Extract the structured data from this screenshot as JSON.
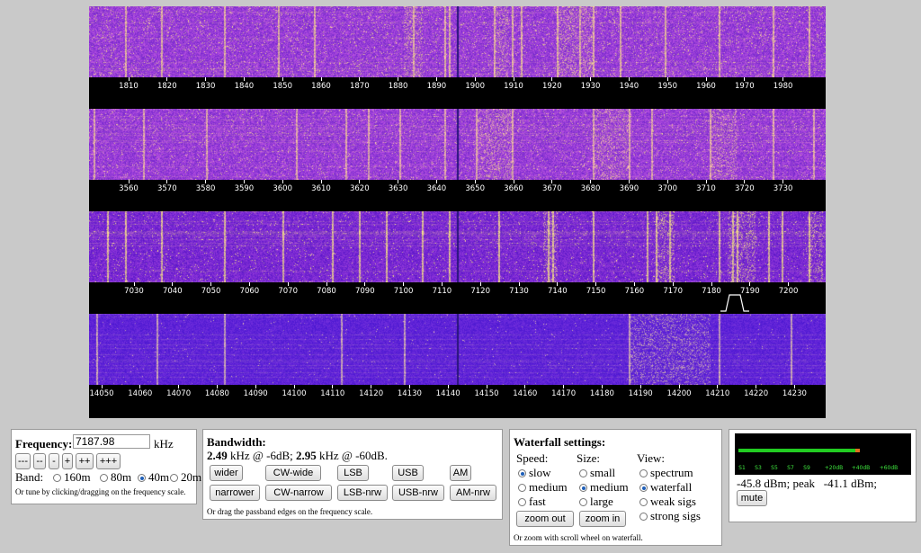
{
  "waterfall": {
    "bands": [
      {
        "labels": [
          "1810",
          "1820",
          "1830",
          "1840",
          "1850",
          "1860",
          "1870",
          "1880",
          "1890",
          "1900",
          "1910",
          "1920",
          "1930",
          "1940",
          "1950",
          "1960",
          "1970",
          "1980"
        ]
      },
      {
        "labels": [
          "3560",
          "3570",
          "3580",
          "3590",
          "3600",
          "3610",
          "3620",
          "3630",
          "3640",
          "3650",
          "3660",
          "3670",
          "3680",
          "3690",
          "3700",
          "3710",
          "3720",
          "3730"
        ]
      },
      {
        "labels": [
          "7030",
          "7040",
          "7050",
          "7060",
          "7070",
          "7080",
          "7090",
          "7100",
          "7110",
          "7120",
          "7130",
          "7140",
          "7150",
          "7160",
          "7170",
          "7180",
          "7190",
          "7200"
        ]
      },
      {
        "labels": [
          "14050",
          "14060",
          "14070",
          "14080",
          "14090",
          "14100",
          "14110",
          "14120",
          "14130",
          "14140",
          "14150",
          "14160",
          "14170",
          "14180",
          "14190",
          "14200",
          "14210",
          "14220",
          "14230"
        ]
      }
    ]
  },
  "frequency": {
    "label": "Frequency:",
    "value": "7187.98",
    "unit": "kHz",
    "step_buttons": [
      "---",
      "--",
      "-",
      "+",
      "++",
      "+++"
    ],
    "band_label": "Band:",
    "bands": [
      {
        "label": "160m",
        "selected": false
      },
      {
        "label": "80m",
        "selected": false
      },
      {
        "label": "40m",
        "selected": true
      },
      {
        "label": "20m",
        "selected": false
      }
    ],
    "hint": "Or tune by clicking/dragging on the frequency scale."
  },
  "bandwidth": {
    "title": "Bandwidth:",
    "value1": "2.49",
    "text1": " kHz @ -6dB; ",
    "value2": "2.95",
    "text2": " kHz @ -60dB.",
    "row1": [
      "wider",
      "CW-wide",
      "LSB",
      "USB",
      "AM"
    ],
    "row2": [
      "narrower",
      "CW-narrow",
      "LSB-nrw",
      "USB-nrw",
      "AM-nrw"
    ],
    "hint": "Or drag the passband edges on the frequency scale."
  },
  "waterfall_settings": {
    "title": "Waterfall settings:",
    "speed_label": "Speed:",
    "speed": [
      {
        "label": "slow",
        "selected": true
      },
      {
        "label": "medium",
        "selected": false
      },
      {
        "label": "fast",
        "selected": false
      }
    ],
    "size_label": "Size:",
    "size": [
      {
        "label": "small",
        "selected": false
      },
      {
        "label": "medium",
        "selected": true
      },
      {
        "label": "large",
        "selected": false
      }
    ],
    "view_label": "View:",
    "view": [
      {
        "label": "spectrum",
        "selected": false
      },
      {
        "label": "waterfall",
        "selected": true
      },
      {
        "label": "weak sigs",
        "selected": false
      },
      {
        "label": "strong sigs",
        "selected": false
      }
    ],
    "zoom_out": "zoom out",
    "zoom_in": "zoom in",
    "hint": "Or zoom with scroll wheel on waterfall."
  },
  "smeter": {
    "scale": [
      "S1",
      "S3",
      "S5",
      "S7",
      "S9",
      "+20dB",
      "+40dB",
      "+60dB"
    ],
    "level": 0.69,
    "bar_color": "#22cc22",
    "peak_color": "#e07020",
    "reading": "-45.8 dBm; peak   -41.1 dBm;",
    "mute": "mute"
  }
}
